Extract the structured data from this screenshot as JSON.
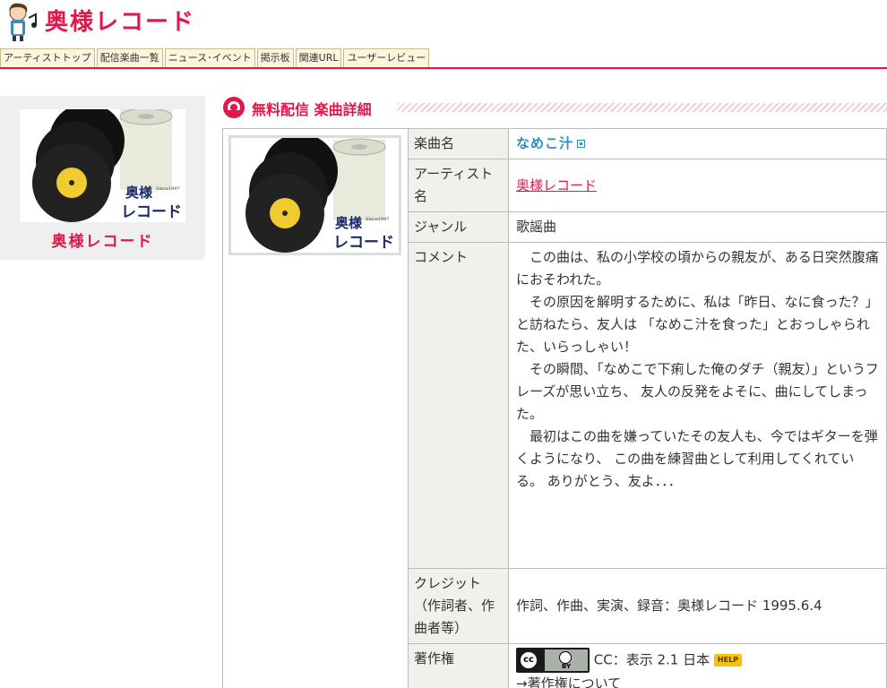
{
  "site": {
    "title": "奥様レコード"
  },
  "nav": {
    "tabs": [
      "アーティストトップ",
      "配信楽曲一覧",
      "ニュース･イベント",
      "掲示板",
      "関連URL",
      "ユーザーレビュー"
    ]
  },
  "sidebar": {
    "artist_name": "奥様レコード"
  },
  "section": {
    "title": "無料配信 楽曲詳細"
  },
  "details": {
    "song_label": "楽曲名",
    "song_title": "なめこ汁",
    "artist_label": "アーティスト名",
    "artist_name": "奥様レコード",
    "genre_label": "ジャンル",
    "genre": "歌謡曲",
    "comment_label": "コメント",
    "comment_paragraphs": [
      "この曲は、私の小学校の頃からの親友が、ある日突然腹痛におそわれた。",
      "その原因を解明するために、私は「昨日、なに食った？」と訪ねたら、友人は 「なめこ汁を食った」とおっしゃられた、いらっしゃい！",
      "その瞬間、「なめこで下痢した俺のダチ（親友）」というフレーズが思い立ち、 友人の反発をよそに、曲にしてしまった。",
      "最初はこの曲を嫌っていたその友人も、今ではギターを弾くようになり、 この曲を練習曲として利用してくれている。 ありがとう、友よ．．．"
    ],
    "credit_label": "クレジット（作詞者、作曲者等）",
    "credit": "作詞、作曲、実演、録音：奥様レコード 1995.6.4",
    "copyright_label": "著作権",
    "license_text": "CC：表示 2.1 日本",
    "help_badge": "HELP",
    "copyright_link": "→著作権について"
  },
  "art": {
    "logo_line1": "奥様",
    "logo_line2": "レコード",
    "since": "Since1997"
  },
  "colors": {
    "brand": "#e0184a",
    "link": "#2e8bc6",
    "key_bg": "#f2f0ea"
  }
}
